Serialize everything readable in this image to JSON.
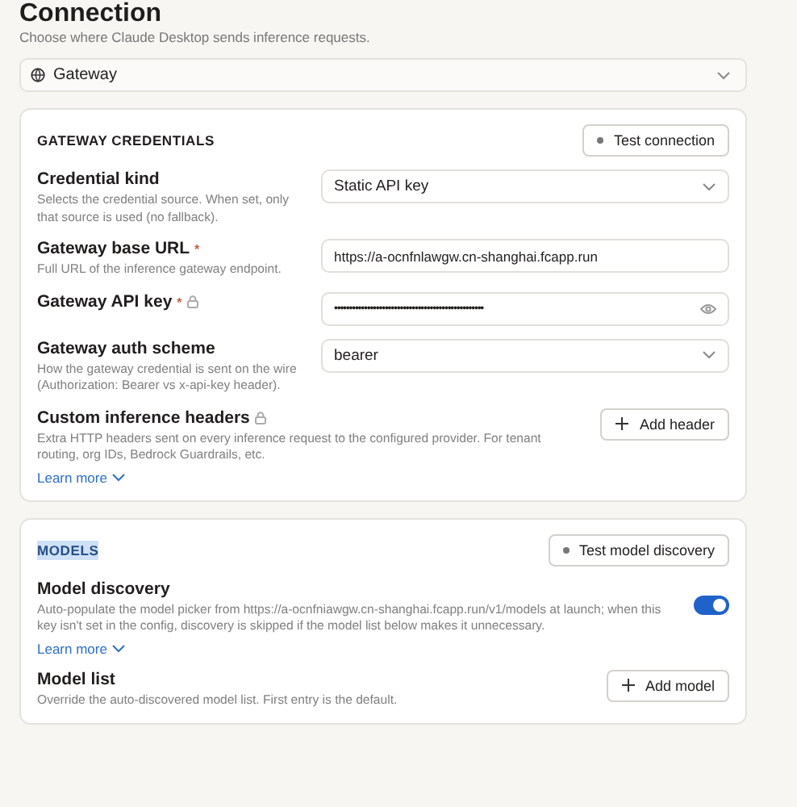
{
  "page": {
    "title": "Connection",
    "subtitle": "Choose where Claude Desktop sends inference requests."
  },
  "provider_select": {
    "value": "Gateway"
  },
  "sections": [
    {
      "title": "GATEWAY CREDENTIALS",
      "highlighted": false,
      "action": "Test connection",
      "fields": [
        {
          "kind": "select",
          "label": "Credential kind",
          "description": "Selects the credential source. When set, only that source is used (no fallback).",
          "value": "Static API key"
        },
        {
          "kind": "text",
          "label": "Gateway base URL",
          "required_mark": "*",
          "description": "Full URL of the inference gateway endpoint.",
          "value": "https://a-ocnfnlawgw.cn-shanghai.fcapp.run"
        },
        {
          "kind": "password",
          "label": "Gateway API key",
          "required_mark": "*",
          "locked": true,
          "value": "••••••••••••••••••••••••••••••••••••••••••••••••••"
        },
        {
          "kind": "select",
          "label": "Gateway auth scheme",
          "description": "How the gateway credential is sent on the wire (Authorization: Bearer vs x-api-key header).",
          "value": "bearer"
        },
        {
          "kind": "button",
          "label": "Custom inference headers",
          "locked": true,
          "description": "Extra HTTP headers sent on every inference request to the configured provider. For tenant routing, org IDs, Bedrock Guardrails, etc.",
          "button": "Add header",
          "learn_more": "Learn more"
        }
      ]
    },
    {
      "title": "MODELS",
      "highlighted": true,
      "action": "Test model discovery",
      "fields": [
        {
          "kind": "toggle",
          "label": "Model discovery",
          "description": "Auto-populate the model picker from https://a-ocnfniawgw.cn-shanghai.fcapp.run/v1/models at launch; when this key isn't set in the config, discovery is skipped if the model list below makes it unnecessary.",
          "on": true,
          "learn_more": "Learn more"
        },
        {
          "kind": "button",
          "label": "Model list",
          "description": "Override the auto-discovered model list. First entry is the default.",
          "button": "Add model"
        }
      ]
    }
  ]
}
